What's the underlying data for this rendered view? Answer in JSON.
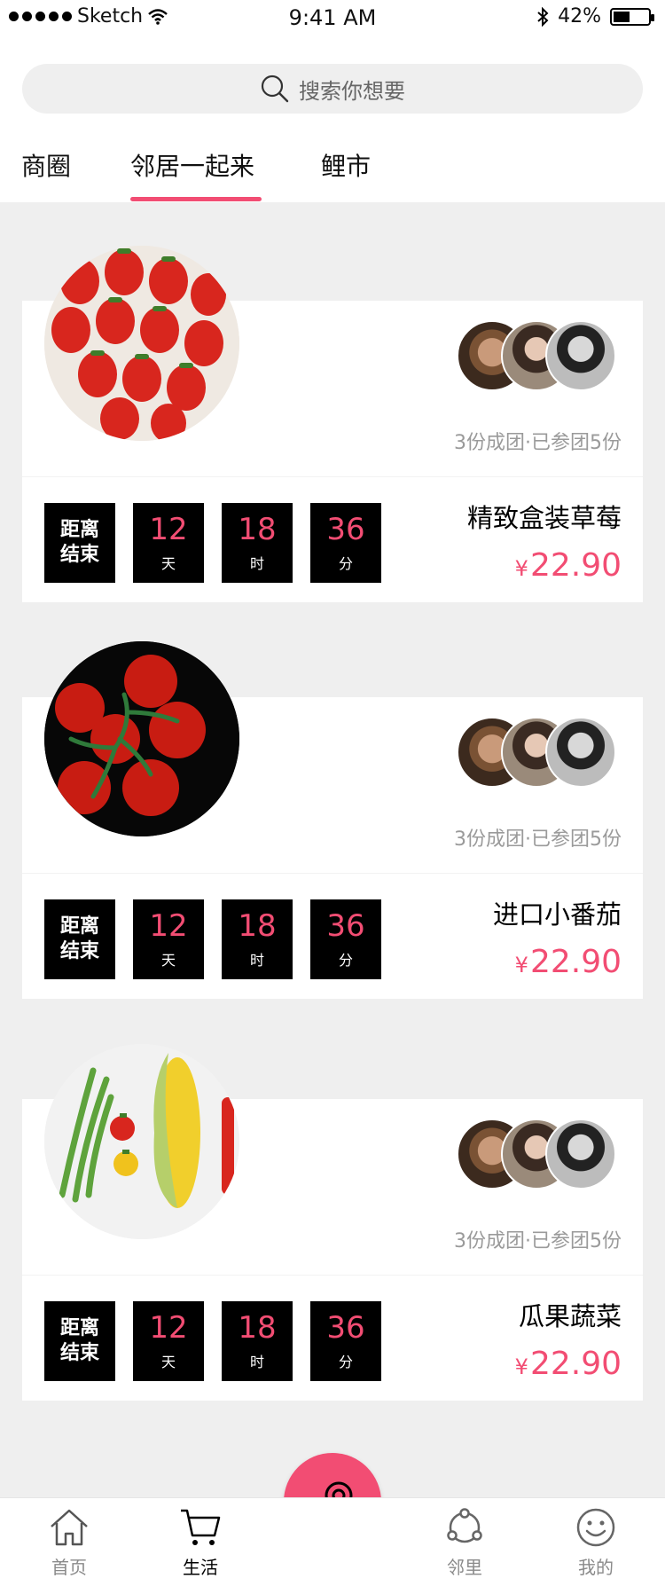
{
  "status_bar": {
    "carrier": "Sketch",
    "time": "9:41 AM",
    "battery": "42%"
  },
  "search": {
    "placeholder": "搜索你想要"
  },
  "tabs": [
    {
      "label": "商圈"
    },
    {
      "label": "邻居一起来",
      "active": true
    },
    {
      "label": "鲤市"
    }
  ],
  "cards": [
    {
      "image_icon": "strawberries-image",
      "group_status": "3份成团·已参团5份",
      "countdown": {
        "label": "距离结束",
        "days": "12",
        "days_unit": "天",
        "hours": "18",
        "hours_unit": "时",
        "minutes": "36",
        "minutes_unit": "分"
      },
      "name": "精致盒装草莓",
      "price_symbol": "¥",
      "price": "22.90"
    },
    {
      "image_icon": "cherry-tomatoes-image",
      "group_status": "3份成团·已参团5份",
      "countdown": {
        "label": "距离结束",
        "days": "12",
        "days_unit": "天",
        "hours": "18",
        "hours_unit": "时",
        "minutes": "36",
        "minutes_unit": "分"
      },
      "name": "进口小番茄",
      "price_symbol": "¥",
      "price": "22.90"
    },
    {
      "image_icon": "corn-beans-image",
      "group_status": "3份成团·已参团5份",
      "countdown": {
        "label": "距离结束",
        "days": "12",
        "days_unit": "天",
        "hours": "18",
        "hours_unit": "时",
        "minutes": "36",
        "minutes_unit": "分"
      },
      "name": "瓜果蔬菜",
      "price_symbol": "¥",
      "price": "22.90"
    }
  ],
  "bottom_nav": [
    {
      "label": "首页",
      "icon": "home-icon"
    },
    {
      "label": "生活",
      "icon": "cart-icon",
      "active": true
    },
    {
      "label": "邻里",
      "icon": "share-network-icon"
    },
    {
      "label": "我的",
      "icon": "smile-icon"
    }
  ],
  "fab": {
    "icon": "key-icon"
  },
  "colors": {
    "accent": "#f24d73",
    "background": "#efefef"
  }
}
